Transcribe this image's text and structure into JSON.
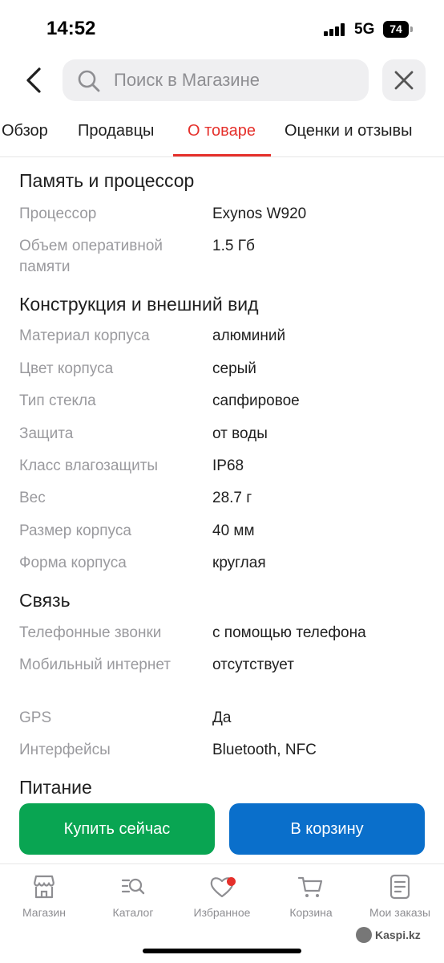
{
  "status_bar": {
    "time": "14:52",
    "network": "5G",
    "battery": "74"
  },
  "search": {
    "placeholder": "Поиск в Магазине"
  },
  "tabs": [
    {
      "label": "Обзор"
    },
    {
      "label": "Продавцы"
    },
    {
      "label": "О товаре",
      "active": true
    },
    {
      "label": "Оценки и отзывы"
    }
  ],
  "sections": [
    {
      "title": "Память и процессор",
      "rows": [
        {
          "label": "Процессор",
          "value": "Exynos W920"
        },
        {
          "label": "Объем оперативной памяти",
          "value": "1.5 Гб"
        }
      ]
    },
    {
      "title": "Конструкция и внешний вид",
      "rows": [
        {
          "label": "Материал корпуса",
          "value": "алюминий"
        },
        {
          "label": "Цвет корпуса",
          "value": "серый"
        },
        {
          "label": "Тип стекла",
          "value": "сапфировое"
        },
        {
          "label": "Защита",
          "value": "от воды"
        },
        {
          "label": "Класс влагозащиты",
          "value": "IP68"
        },
        {
          "label": "Вес",
          "value": "28.7 г"
        },
        {
          "label": "Размер корпуса",
          "value": "40 мм"
        },
        {
          "label": "Форма корпуса",
          "value": "круглая"
        }
      ]
    },
    {
      "title": "Связь",
      "rows": [
        {
          "label": "Телефонные звонки",
          "value": "с помощью телефона"
        },
        {
          "label": "Мобильный интернет",
          "value": "отсутствует"
        },
        {
          "label": "GPS",
          "value": "Да"
        },
        {
          "label": "Интерфейсы",
          "value": "Bluetooth, NFC"
        }
      ]
    },
    {
      "title": "Питание",
      "rows": []
    }
  ],
  "actions": {
    "buy_label": "Купить сейчас",
    "cart_label": "В корзину"
  },
  "bottom_nav": [
    {
      "label": "Магазин",
      "icon": "store-icon"
    },
    {
      "label": "Каталог",
      "icon": "catalog-search-icon"
    },
    {
      "label": "Избранное",
      "icon": "heart-icon",
      "has_badge": true
    },
    {
      "label": "Корзина",
      "icon": "cart-icon"
    },
    {
      "label": "Мои заказы",
      "icon": "orders-icon"
    }
  ],
  "watermark": "Kaspi.kz",
  "colors": {
    "accent_red": "#e5302b",
    "buy_green": "#09a552",
    "cart_blue": "#0a6fcb",
    "label_gray": "#9a9a9e"
  }
}
